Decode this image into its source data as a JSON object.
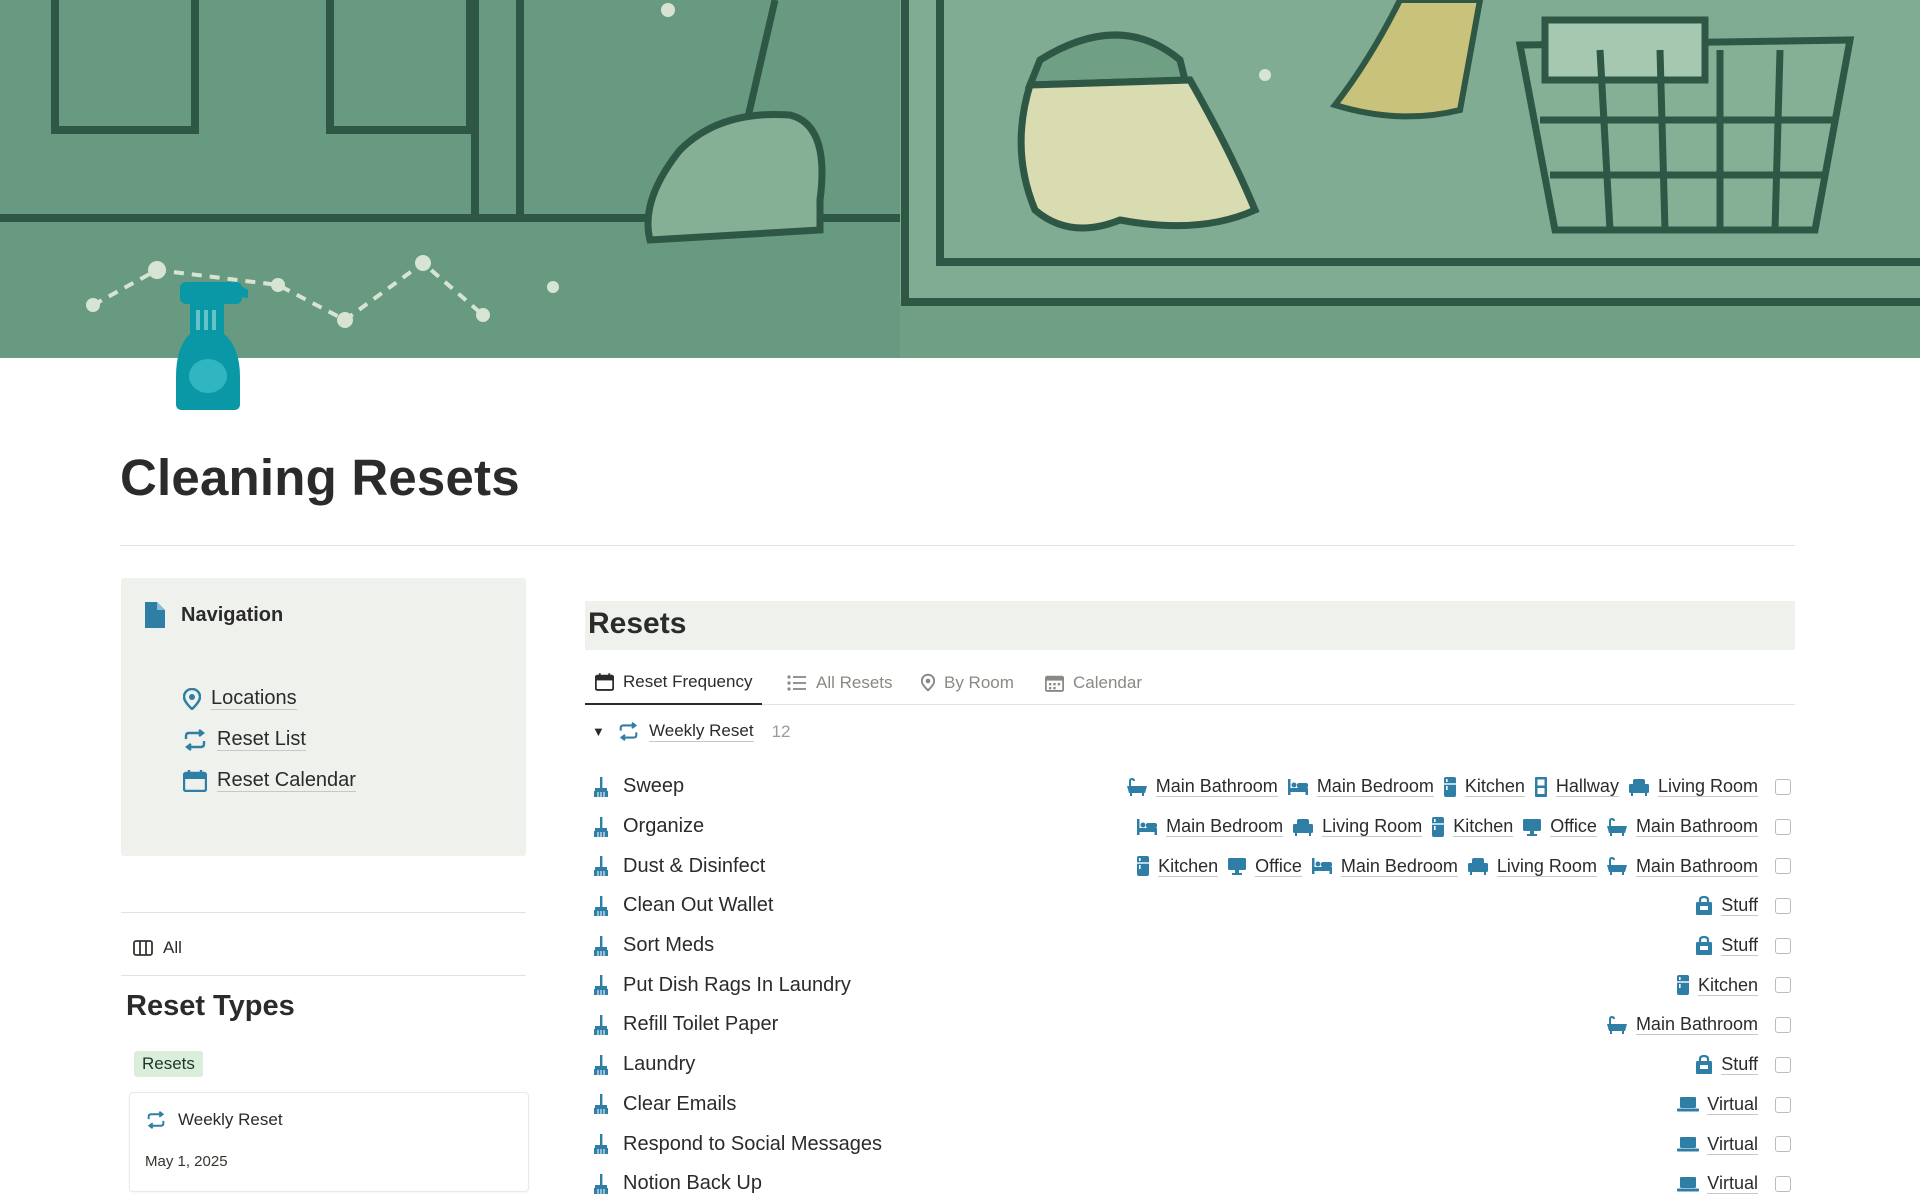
{
  "page": {
    "title": "Cleaning Resets"
  },
  "colors": {
    "accent_icon": "#2f7ea6",
    "cover_green": "#6f9f85",
    "callout_bg": "#eff2ec",
    "tag_bg": "#dbeddb"
  },
  "navigation": {
    "title": "Navigation",
    "links": [
      {
        "label": "Locations",
        "icon": "map-pin-icon"
      },
      {
        "label": "Reset List",
        "icon": "repeat-icon"
      },
      {
        "label": "Reset Calendar",
        "icon": "calendar-icon"
      }
    ]
  },
  "reset_types": {
    "view_label": "All",
    "heading": "Reset Types",
    "tag": "Resets",
    "card": {
      "title": "Weekly Reset",
      "date": "May 1, 2025"
    }
  },
  "resets": {
    "heading": "Resets",
    "tabs": [
      {
        "label": "Reset Frequency",
        "icon": "calendar-icon",
        "active": true
      },
      {
        "label": "All Resets",
        "icon": "list-icon",
        "active": false
      },
      {
        "label": "By Room",
        "icon": "map-pin-icon",
        "active": false
      },
      {
        "label": "Calendar",
        "icon": "calendar-grid-icon",
        "active": false
      }
    ],
    "group": {
      "name": "Weekly Reset",
      "count": "12"
    },
    "rows": [
      {
        "task": "Sweep",
        "rooms": [
          {
            "name": "Main Bathroom",
            "icon": "bathtub-icon"
          },
          {
            "name": "Main Bedroom",
            "icon": "bed-icon"
          },
          {
            "name": "Kitchen",
            "icon": "fridge-icon"
          },
          {
            "name": "Hallway",
            "icon": "door-icon"
          },
          {
            "name": "Living Room",
            "icon": "armchair-icon"
          }
        ]
      },
      {
        "task": "Organize",
        "rooms": [
          {
            "name": "Main Bedroom",
            "icon": "bed-icon"
          },
          {
            "name": "Living Room",
            "icon": "armchair-icon"
          },
          {
            "name": "Kitchen",
            "icon": "fridge-icon"
          },
          {
            "name": "Office",
            "icon": "monitor-icon"
          },
          {
            "name": "Main Bathroom",
            "icon": "bathtub-icon"
          }
        ]
      },
      {
        "task": "Dust & Disinfect",
        "rooms": [
          {
            "name": "Kitchen",
            "icon": "fridge-icon"
          },
          {
            "name": "Office",
            "icon": "monitor-icon"
          },
          {
            "name": "Main Bedroom",
            "icon": "bed-icon"
          },
          {
            "name": "Living Room",
            "icon": "armchair-icon"
          },
          {
            "name": "Main Bathroom",
            "icon": "bathtub-icon"
          }
        ]
      },
      {
        "task": "Clean Out Wallet",
        "rooms": [
          {
            "name": "Stuff",
            "icon": "bag-icon"
          }
        ]
      },
      {
        "task": "Sort Meds",
        "rooms": [
          {
            "name": "Stuff",
            "icon": "bag-icon"
          }
        ]
      },
      {
        "task": "Put Dish Rags In Laundry",
        "rooms": [
          {
            "name": "Kitchen",
            "icon": "fridge-icon"
          }
        ]
      },
      {
        "task": "Refill Toilet Paper",
        "rooms": [
          {
            "name": "Main Bathroom",
            "icon": "bathtub-icon"
          }
        ]
      },
      {
        "task": "Laundry",
        "rooms": [
          {
            "name": "Stuff",
            "icon": "bag-icon"
          }
        ]
      },
      {
        "task": "Clear Emails",
        "rooms": [
          {
            "name": "Virtual",
            "icon": "laptop-icon"
          }
        ]
      },
      {
        "task": "Respond to Social Messages",
        "rooms": [
          {
            "name": "Virtual",
            "icon": "laptop-icon"
          }
        ]
      },
      {
        "task": "Notion Back Up",
        "rooms": [
          {
            "name": "Virtual",
            "icon": "laptop-icon"
          }
        ]
      }
    ]
  }
}
